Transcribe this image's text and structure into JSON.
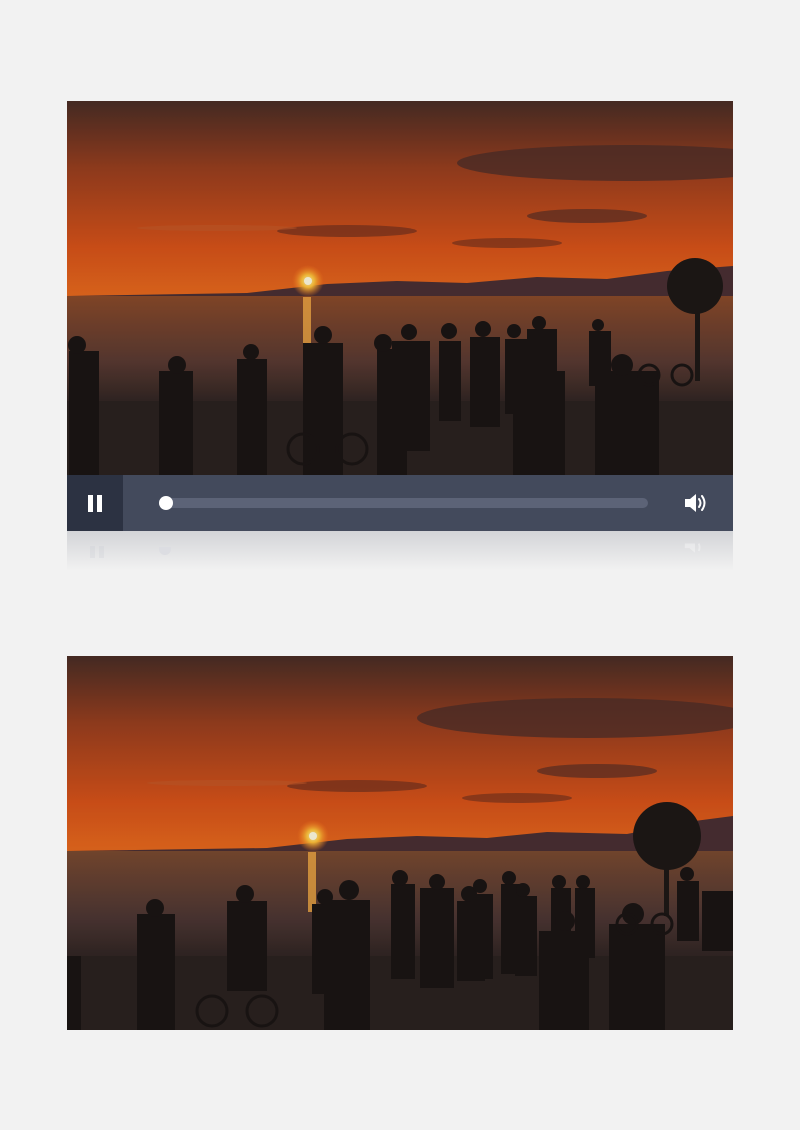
{
  "video_player": {
    "state": "playing",
    "progress_fraction": 0.0,
    "controls": {
      "pause_icon": "pause-icon",
      "volume_icon": "volume-icon"
    }
  },
  "colors": {
    "controls_bg": "#434a5c",
    "play_button_bg": "#2c3242",
    "track": "#5c6377",
    "page_bg": "#f2f2f2"
  }
}
